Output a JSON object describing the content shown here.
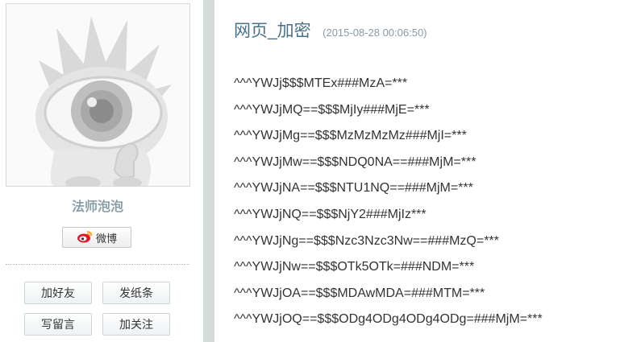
{
  "sidebar": {
    "username": "法师泡泡",
    "weibo_label": "微博",
    "actions": {
      "add_friend": "加好友",
      "send_note": "发纸条",
      "leave_message": "写留言",
      "follow": "加关注"
    }
  },
  "post": {
    "title": "网页_加密",
    "timestamp": "(2015-08-28 00:06:50)",
    "lines": [
      "^^^YWJj$$$MTEx###MzA=***",
      "^^^YWJjMQ==$$$MjIy###MjE=***",
      "^^^YWJjMg==$$$MzMzMzMz###MjI=***",
      "^^^YWJjMw==$$$NDQ0NA==###MjM=***",
      "^^^YWJjNA==$$$NTU1NQ==###MjM=***",
      "^^^YWJjNQ==$$$NjY2###MjIz***",
      "^^^YWJjNg==$$$Nzc3Nzc3Nw==###MzQ=***",
      "^^^YWJjNw==$$$OTk5OTk=###NDM=***",
      "^^^YWJjOA==$$$MDAwMDA=###MTM=***",
      "^^^YWJjOQ==$$$ODg4ODg4ODg4ODg=###MjM=***"
    ]
  }
}
